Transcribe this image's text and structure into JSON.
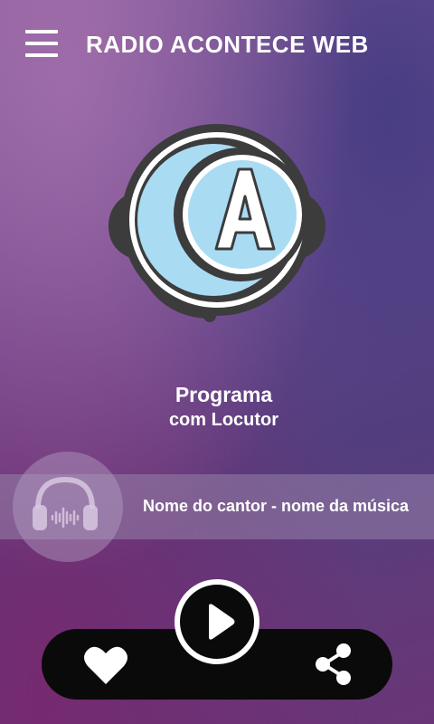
{
  "header": {
    "title": "RADIO ACONTECE WEB",
    "menu_icon": "hamburger-menu-icon"
  },
  "logo": {
    "letter": "A",
    "icon": "radio-headset-logo"
  },
  "program": {
    "title": "Programa",
    "host": "com Locutor"
  },
  "now_playing": {
    "track": "Nome do cantor - nome da música",
    "cover_icon": "headphones-icon"
  },
  "controls": {
    "favorite_icon": "heart-icon",
    "play_icon": "play-icon",
    "share_icon": "share-icon"
  },
  "colors": {
    "logo_light_blue": "#a9dcf3",
    "logo_ring_dark": "#3c3c3c",
    "bar_black": "#0a0a0a"
  }
}
